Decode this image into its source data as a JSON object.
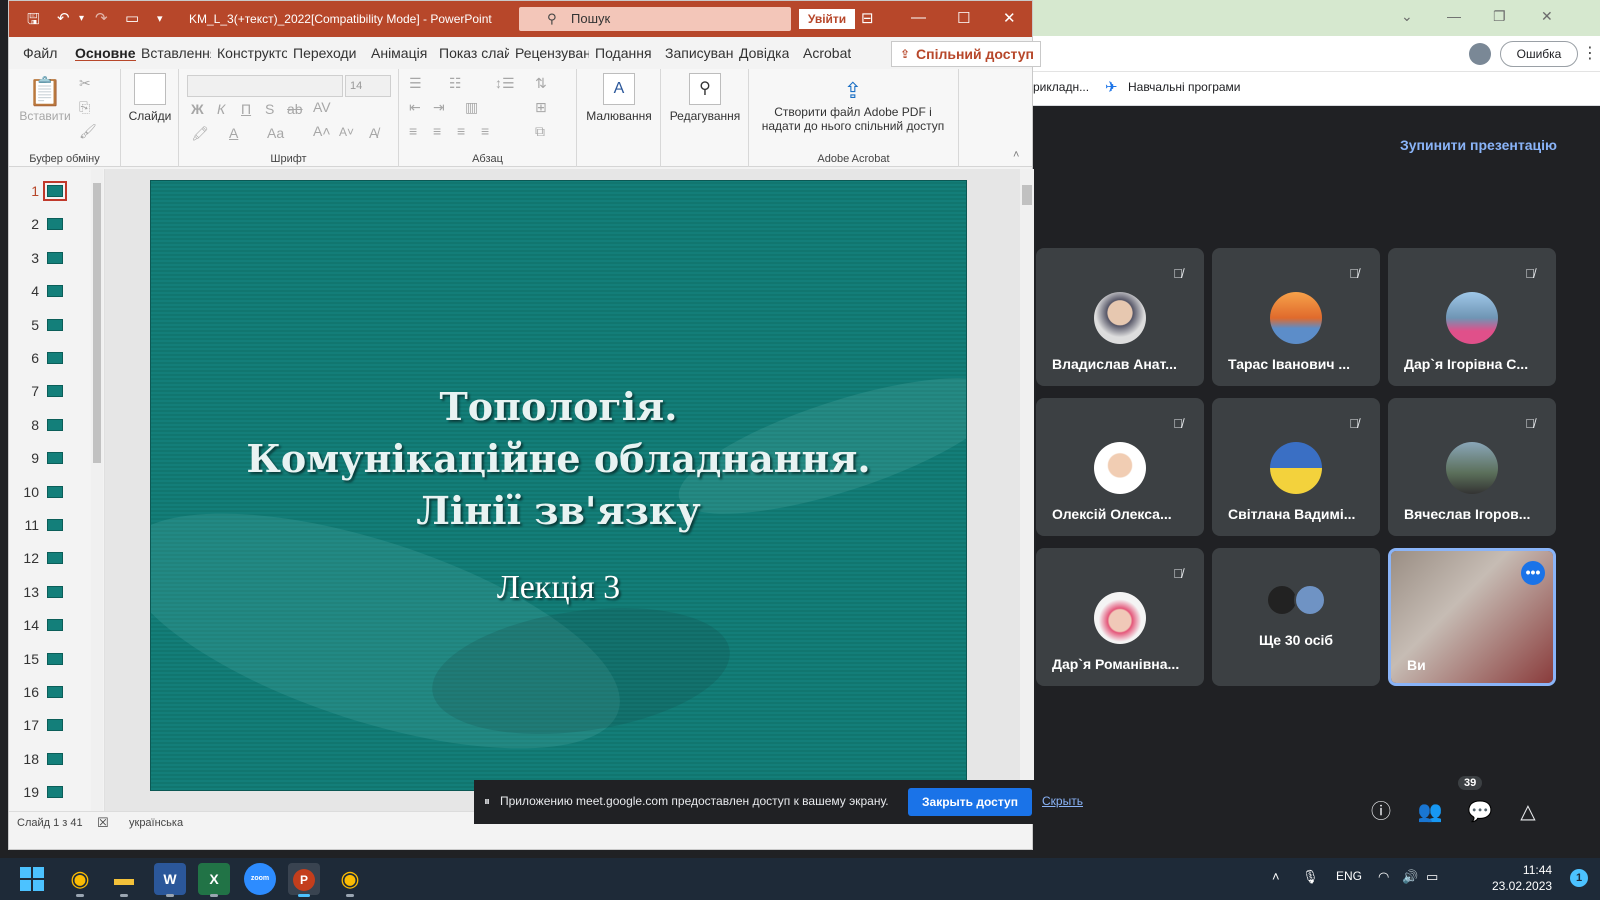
{
  "chrome": {
    "error_button": "Ошибка",
    "bookmarks": [
      "рикладн...",
      "Навчальні програми"
    ]
  },
  "meet": {
    "stop_presentation": "Зупинити презентацію",
    "participants": [
      {
        "name": "Владислав Анат..."
      },
      {
        "name": "Тарас Іванович ..."
      },
      {
        "name": "Дар`я Ігорівна С..."
      },
      {
        "name": "Олексій Олекса..."
      },
      {
        "name": "Світлана Вадимі..."
      },
      {
        "name": "Вячеслав Ігоров..."
      },
      {
        "name": "Дар`я Романівна..."
      }
    ],
    "more_people": "Ще 30 осіб",
    "self_name": "Ви",
    "people_count": "39"
  },
  "ppt": {
    "title": "KM_L_3(+текст)_2022[Compatibility Mode]  -  PowerPoint",
    "search_placeholder": "Пошук",
    "login": "Увійти",
    "tabs": [
      "Файл",
      "Основне",
      "Вставлення",
      "Конструктор",
      "Переходи",
      "Анімація",
      "Показ слайдів",
      "Рецензування",
      "Подання",
      "Записування",
      "Довідка",
      "Acrobat"
    ],
    "share": "Спільний доступ",
    "ribbon": {
      "paste": "Вставити",
      "slides": "Слайди",
      "font_size": "14",
      "drawing": "Малювання",
      "editing": "Редагування",
      "acrobat_line1": "Створити файл Adobe PDF і",
      "acrobat_line2": "надати до нього спільний доступ",
      "group_clipboard": "Буфер обміну",
      "group_font": "Шрифт",
      "group_paragraph": "Абзац",
      "group_acrobat": "Adobe Acrobat"
    },
    "slide_numbers": [
      "1",
      "2",
      "3",
      "4",
      "5",
      "6",
      "7",
      "8",
      "9",
      "10",
      "11",
      "12",
      "13",
      "14",
      "15",
      "16",
      "17",
      "18",
      "19"
    ],
    "slide": {
      "title_line1": "Топологія.",
      "title_line2": "Комунікаційне обладнання.",
      "title_line3": "Лінії зв'язку",
      "subtitle": "Лекція 3"
    },
    "status": {
      "slide_count": "Слайд 1 з 41",
      "language": "українська"
    }
  },
  "share_bar": {
    "message": "Приложению meet.google.com предоставлен доступ к вашему экрану.",
    "stop": "Закрыть доступ",
    "hide": "Скрыть"
  },
  "taskbar": {
    "zoom_label": "zoom",
    "lang": "ENG",
    "time": "11:44",
    "date": "23.02.2023",
    "notifications": "1"
  }
}
